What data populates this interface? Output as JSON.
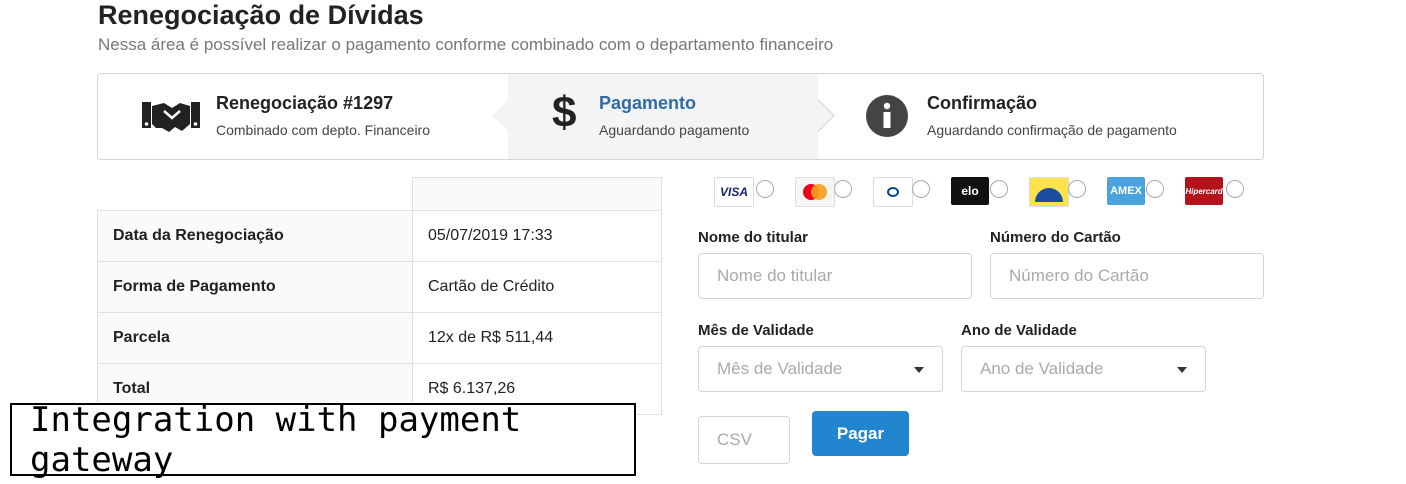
{
  "page": {
    "title": "Renegociação de Dívidas",
    "subtitle": "Nessa área é possível realizar o pagamento conforme combinado com o departamento financeiro"
  },
  "steps": [
    {
      "icon": "handshake-icon",
      "title": "Renegociação #1297",
      "desc": "Combinado com depto. Financeiro",
      "active": false
    },
    {
      "icon": "dollar-icon",
      "title": "Pagamento",
      "desc": "Aguardando pagamento",
      "active": true
    },
    {
      "icon": "info-icon",
      "title": "Confirmação",
      "desc": "Aguardando confirmação de pagamento",
      "active": false
    }
  ],
  "summary": {
    "rows": [
      {
        "label": "Data da Renegociação",
        "value": "05/07/2019 17:33"
      },
      {
        "label": "Forma de Pagamento",
        "value": "Cartão de Crédito"
      },
      {
        "label": "Parcela",
        "value": "12x de R$ 511,44"
      },
      {
        "label": "Total",
        "value": "R$ 6.137,26"
      }
    ]
  },
  "brands": [
    "VISA",
    "MasterCard",
    "Diners Club",
    "elo",
    "Aura",
    "AMEX",
    "Hipercard"
  ],
  "form": {
    "holder_label": "Nome do titular",
    "holder_placeholder": "Nome do titular",
    "card_label": "Número do Cartão",
    "card_placeholder": "Número do Cartão",
    "month_label": "Mês de Validade",
    "month_placeholder": "Mês de Validade",
    "year_label": "Ano de Validade",
    "year_placeholder": "Ano de Validade",
    "csv_placeholder": "CSV",
    "pay_button": "Pagar"
  },
  "overlay_caption": "Integration with payment gateway",
  "colors": {
    "accent": "#2185d0",
    "active_step_bg": "#f3f4f5"
  }
}
